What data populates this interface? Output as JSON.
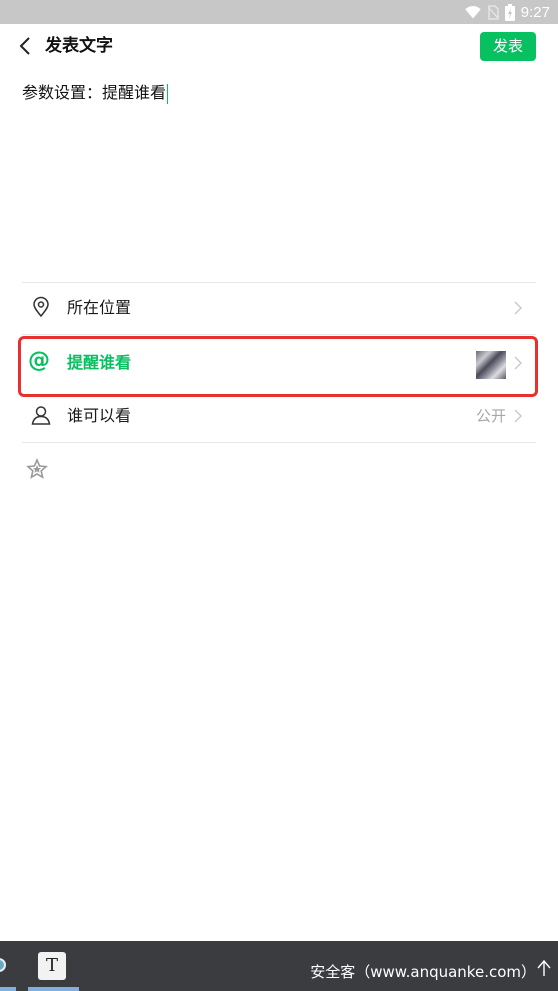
{
  "status_bar": {
    "time": "9:27",
    "icons": [
      "wifi-icon",
      "no-sim-icon",
      "battery-icon"
    ]
  },
  "header": {
    "title": "发表文字",
    "publish_label": "发表"
  },
  "compose": {
    "text": "参数设置：提醒谁看"
  },
  "options": [
    {
      "icon": "location-pin-icon",
      "label": "所在位置",
      "value": ""
    },
    {
      "icon": "at-icon",
      "label": "提醒谁看",
      "value": ""
    },
    {
      "icon": "person-icon",
      "label": "谁可以看",
      "value": "公开"
    }
  ],
  "at_symbol": "@",
  "taskbar": {
    "app_letter": "T",
    "watermark": "安全客（www.anquanke.com）"
  },
  "colors": {
    "accent": "#07c160",
    "highlight": "#e8302e",
    "muted": "#a8a8a8"
  }
}
